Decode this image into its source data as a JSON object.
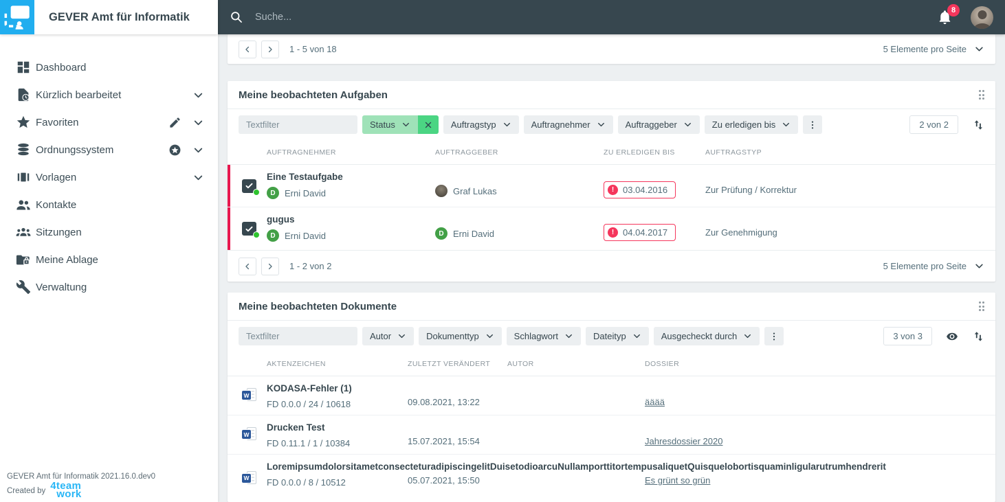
{
  "app": {
    "title": "GEVER Amt für Informatik",
    "search_placeholder": "Suche...",
    "notification_count": "8"
  },
  "sidebar": {
    "items": [
      {
        "label": "Dashboard"
      },
      {
        "label": "Kürzlich bearbeitet"
      },
      {
        "label": "Favoriten"
      },
      {
        "label": "Ordnungssystem"
      },
      {
        "label": "Vorlagen"
      },
      {
        "label": "Kontakte"
      },
      {
        "label": "Sitzungen"
      },
      {
        "label": "Meine Ablage"
      },
      {
        "label": "Verwaltung"
      }
    ],
    "footer": {
      "version": "GEVER Amt für Informatik 2021.16.0.dev0",
      "created_by": "Created by",
      "brand_top": "4team",
      "brand_bottom": "work"
    }
  },
  "top_strip": {
    "range": "1 - 5 von 18",
    "per_page": "5 Elemente pro Seite"
  },
  "tasks_card": {
    "title": "Meine beobachteten Aufgaben",
    "filters": {
      "text_placeholder": "Textfilter",
      "active_pill": "Status",
      "pills": [
        "Auftragstyp",
        "Auftragnehmer",
        "Auftraggeber",
        "Zu erledigen bis"
      ]
    },
    "count": "2 von 2",
    "columns": [
      "AUFTRAGNEHMER",
      "AUFTRAGGEBER",
      "ZU ERLEDIGEN BIS",
      "AUFTRAGSTYP"
    ],
    "rows": [
      {
        "title": "Eine Testaufgabe",
        "assignee": "Erni David",
        "assignee_initial": "D",
        "issuer": "Graf Lukas",
        "due": "03.04.2016",
        "task_type": "Zur Prüfung / Korrektur"
      },
      {
        "title": "gugus",
        "assignee": "Erni David",
        "assignee_initial": "D",
        "issuer": "Erni David",
        "issuer_initial": "D",
        "due": "04.04.2017",
        "task_type": "Zur Genehmigung"
      }
    ],
    "pagination": {
      "range": "1 - 2 von 2",
      "per_page": "5 Elemente pro Seite"
    }
  },
  "documents_card": {
    "title": "Meine beobachteten Dokumente",
    "filters": {
      "text_placeholder": "Textfilter",
      "pills": [
        "Autor",
        "Dokumenttyp",
        "Schlagwort",
        "Dateityp",
        "Ausgecheckt durch"
      ]
    },
    "count": "3 von 3",
    "columns": [
      "AKTENZEICHEN",
      "ZULETZT VERÄNDERT",
      "AUTOR",
      "DOSSIER"
    ],
    "rows": [
      {
        "title": "KODASA-Fehler (1)",
        "reference": "FD 0.0.0 / 24 / 10618",
        "modified": "09.08.2021, 13:22",
        "author": "",
        "dossier": "ääää"
      },
      {
        "title": "Drucken Test",
        "reference": "FD 0.11.1 / 1 / 10384",
        "modified": "15.07.2021, 15:54",
        "author": "",
        "dossier": "Jahresdossier 2020"
      },
      {
        "title": "LoremipsumdolorsitametconsecteturadipiscingelitDuisetodioarcuNullamporttitortempusaliquetQuisquelobortisquaminligularutrumhendrerit",
        "reference": "FD 0.0.0 / 8 / 10512",
        "modified": "05.07.2021, 15:50",
        "author": "",
        "dossier": "Es grünt so grün"
      }
    ]
  },
  "icons": {
    "word_letter": "W",
    "overdue_mark": "!"
  },
  "colors": {
    "topbar": "#37474f",
    "logo_blue": "#21aeef",
    "brand_cyan": "#29b6f6",
    "accent_red": "#e8174f",
    "alert_red": "#f5365c",
    "avatar_green": "#43a047",
    "status_dot_green": "#2fc32f",
    "filter_active_bg": "#9fe2b8",
    "filter_clear_bg": "#4bd583",
    "word_blue": "#2b579a"
  }
}
